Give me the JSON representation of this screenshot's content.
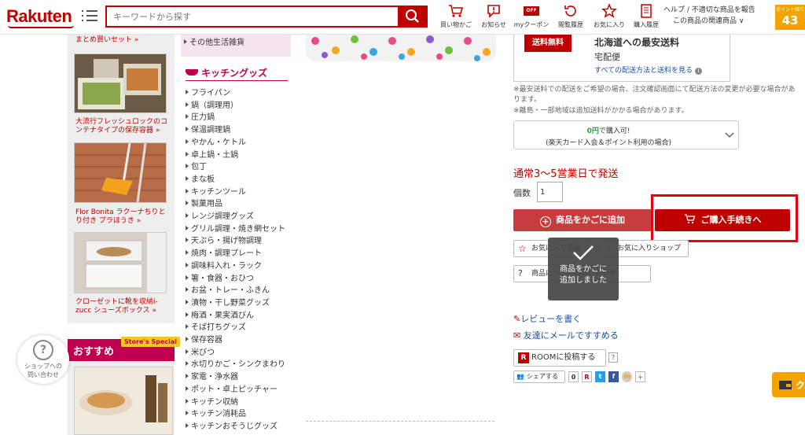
{
  "header": {
    "logo": "Rakuten",
    "search_placeholder": "キーワードから探す",
    "nav": [
      {
        "label": "買い物かご"
      },
      {
        "label": "お知らせ"
      },
      {
        "label": "myクーポン"
      },
      {
        "label": "閲覧履歴"
      },
      {
        "label": "お気に入り"
      },
      {
        "label": "購入履歴"
      }
    ],
    "coupon_badge": "OFF",
    "help_line1": "ヘルプ / 不適切な商品を報告",
    "help_line2": "この商品の関連商品",
    "points_label": "ポイント残り",
    "points_value": "43"
  },
  "left": {
    "top_caption": "まとめ買いセット »",
    "thumb1_caption": "大流行フレッシュロックのコンテナタイプの保存容器 »",
    "thumb2_caption": "Flor Bonita ラクーナちりとり付き プラほうき »",
    "thumb3_caption": "クローゼットに靴を収納i-zucc シューズボックス »",
    "osusume": "おすすめ",
    "store_special": "Store's Special",
    "contact_line1": "ショップへの",
    "contact_line2": "問い合わせ"
  },
  "categories": {
    "other": "その他生活雑貨",
    "kitchen_title": "キッチングッズ",
    "items": [
      "フライパン",
      "鍋（調理用）",
      "圧力鍋",
      "保温調理鍋",
      "やかん・ケトル",
      "卓上鍋・土鍋",
      "包丁",
      "まな板",
      "キッチンツール",
      "製菓用品",
      "レンジ調理グッズ",
      "グリル調理・焼き網セット",
      "天ぷら・揚げ物調理",
      "焼肉・調理プレート",
      "調味料入れ・ラック",
      "箸・食器・おひつ",
      "お盆・トレー・ふきん",
      "漬物・干し野菜グッズ",
      "梅酒・果実酒びん",
      "そば打ちグッズ",
      "保存容器",
      "米びつ",
      "水切りかご・シンクまわり",
      "家電・浄水器",
      "ポット・卓上ピッチャー",
      "キッチン収納",
      "キッチン消耗品",
      "キッチンおそうじグッズ"
    ]
  },
  "shipping": {
    "free_tag": "送料無料",
    "title": "北海道への最安送料",
    "method": "宅配便",
    "link": "すべての配送方法と送料を見る",
    "note1": "※最安送料での配送をご希望の場合、注文確認画面にて配送方法の変更が必要な場合があります。",
    "note2": "※離島・一部地域は追加送料がかかる場合があります。"
  },
  "payment": {
    "amount": "0円",
    "amount_suffix": "で購入可!",
    "sub": "(楽天カード入会＆ポイント利用の場合)"
  },
  "purchase": {
    "delivery": "通常3〜5営業日で発送",
    "qty_label": "個数",
    "qty_value": "1",
    "add_cart": "商品をかごに追加",
    "checkout": "ご購入手続きへ",
    "fav_item": "お気に入り商品",
    "fav_shop": "お気に入りショップ",
    "inquiry": "商品についての問い合わせ",
    "toast_line1": "商品をかごに",
    "toast_line2": "追加しました"
  },
  "links": {
    "review": "レビューを書く",
    "mail": "友達にメールですすめる",
    "room": "ROOMに投稿する",
    "room_help": "?",
    "share": "シェアする",
    "share_count": "0"
  },
  "colors": {
    "brand": "#bf0000",
    "highlight": "#e60012",
    "accent_pink": "#c0004e"
  }
}
